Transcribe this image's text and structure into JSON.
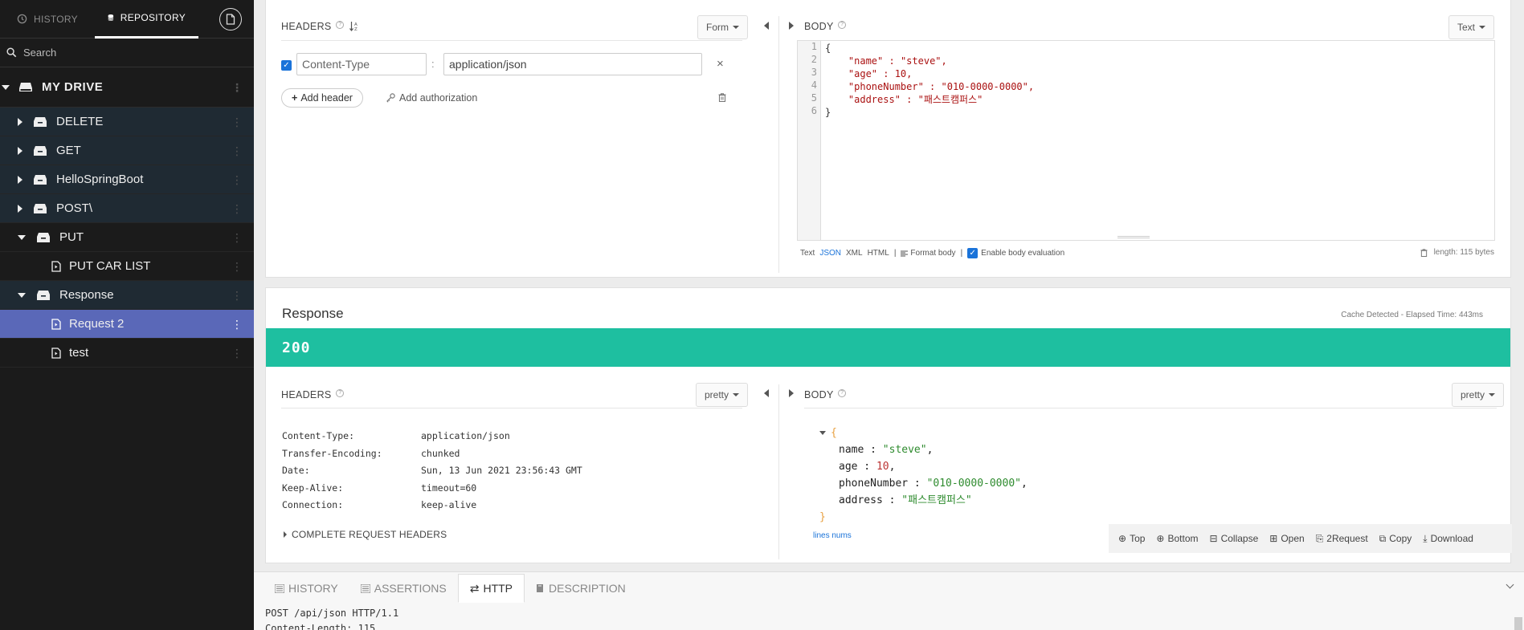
{
  "sidebar": {
    "tabs": {
      "history": "HISTORY",
      "repository": "REPOSITORY"
    },
    "search_placeholder": "Search",
    "drive": "MY DRIVE",
    "items": [
      {
        "label": "DELETE",
        "type": "folder"
      },
      {
        "label": "GET",
        "type": "folder"
      },
      {
        "label": "HelloSpringBoot",
        "type": "folder"
      },
      {
        "label": "POST\\",
        "type": "folder"
      },
      {
        "label": "PUT",
        "type": "folder"
      },
      {
        "label": "PUT CAR LIST",
        "type": "request"
      },
      {
        "label": "Response",
        "type": "folder"
      },
      {
        "label": "Request 2",
        "type": "request"
      },
      {
        "label": "test",
        "type": "request"
      }
    ]
  },
  "request": {
    "headers_label": "HEADERS",
    "form_label": "Form",
    "header_name": "Content-Type",
    "header_value": "application/json",
    "add_header": "Add header",
    "add_auth": "Add authorization",
    "body_label": "BODY",
    "body_mode": "Text",
    "line_numbers": [
      "1",
      "2",
      "3",
      "4",
      "5",
      "6"
    ],
    "code": {
      "l1": "{",
      "k_name": "\"name\"",
      "v_name": " : \"steve\",",
      "k_age": "\"age\"",
      "v_age": " : 10,",
      "k_phone": "\"phoneNumber\"",
      "v_phone": " : \"010-0000-0000\",",
      "k_addr": "\"address\"",
      "v_addr": " : \"패스트캠퍼스\"",
      "l6": "}"
    },
    "formats": {
      "text": "Text",
      "json": "JSON",
      "xml": "XML",
      "html": "HTML",
      "sep": "|",
      "format_body": "Format body",
      "enable_eval": "Enable body evaluation"
    },
    "length": "length: 115 bytes"
  },
  "response": {
    "title": "Response",
    "meta": "Cache Detected - Elapsed Time: 443ms",
    "status": "200",
    "headers_label": "HEADERS",
    "headers_mode": "pretty",
    "body_label": "BODY",
    "body_mode": "pretty",
    "headers": [
      {
        "k": "Content-Type:",
        "v": "application/json"
      },
      {
        "k": "Transfer-Encoding:",
        "v": "chunked"
      },
      {
        "k": "Date:",
        "v": "Sun, 13 Jun 2021 23:56:43 GMT"
      },
      {
        "k": "Keep-Alive:",
        "v": "timeout=60"
      },
      {
        "k": "Connection:",
        "v": "keep-alive"
      }
    ],
    "complete_headers": "COMPLETE REQUEST HEADERS",
    "json": {
      "open": "{",
      "close": "}",
      "name_k": "name",
      "name_v": "\"steve\"",
      "age_k": "age",
      "age_v": "10",
      "phone_k": "phoneNumber",
      "phone_v": "\"010-0000-0000\"",
      "addr_k": "address",
      "addr_v": "\"패스트캠퍼스\"",
      "colon": " : ",
      "comma": ","
    },
    "lines_nums": "lines nums",
    "toolbar": {
      "top": "Top",
      "bottom": "Bottom",
      "collapse": "Collapse",
      "open": "Open",
      "to_request": "2Request",
      "copy": "Copy",
      "download": "Download"
    }
  },
  "bottom": {
    "tabs": {
      "history": "HISTORY",
      "assertions": "ASSERTIONS",
      "http": "HTTP",
      "description": "DESCRIPTION"
    },
    "line1": "POST /api/json HTTP/1.1",
    "line2": "Content-Length: 115"
  }
}
